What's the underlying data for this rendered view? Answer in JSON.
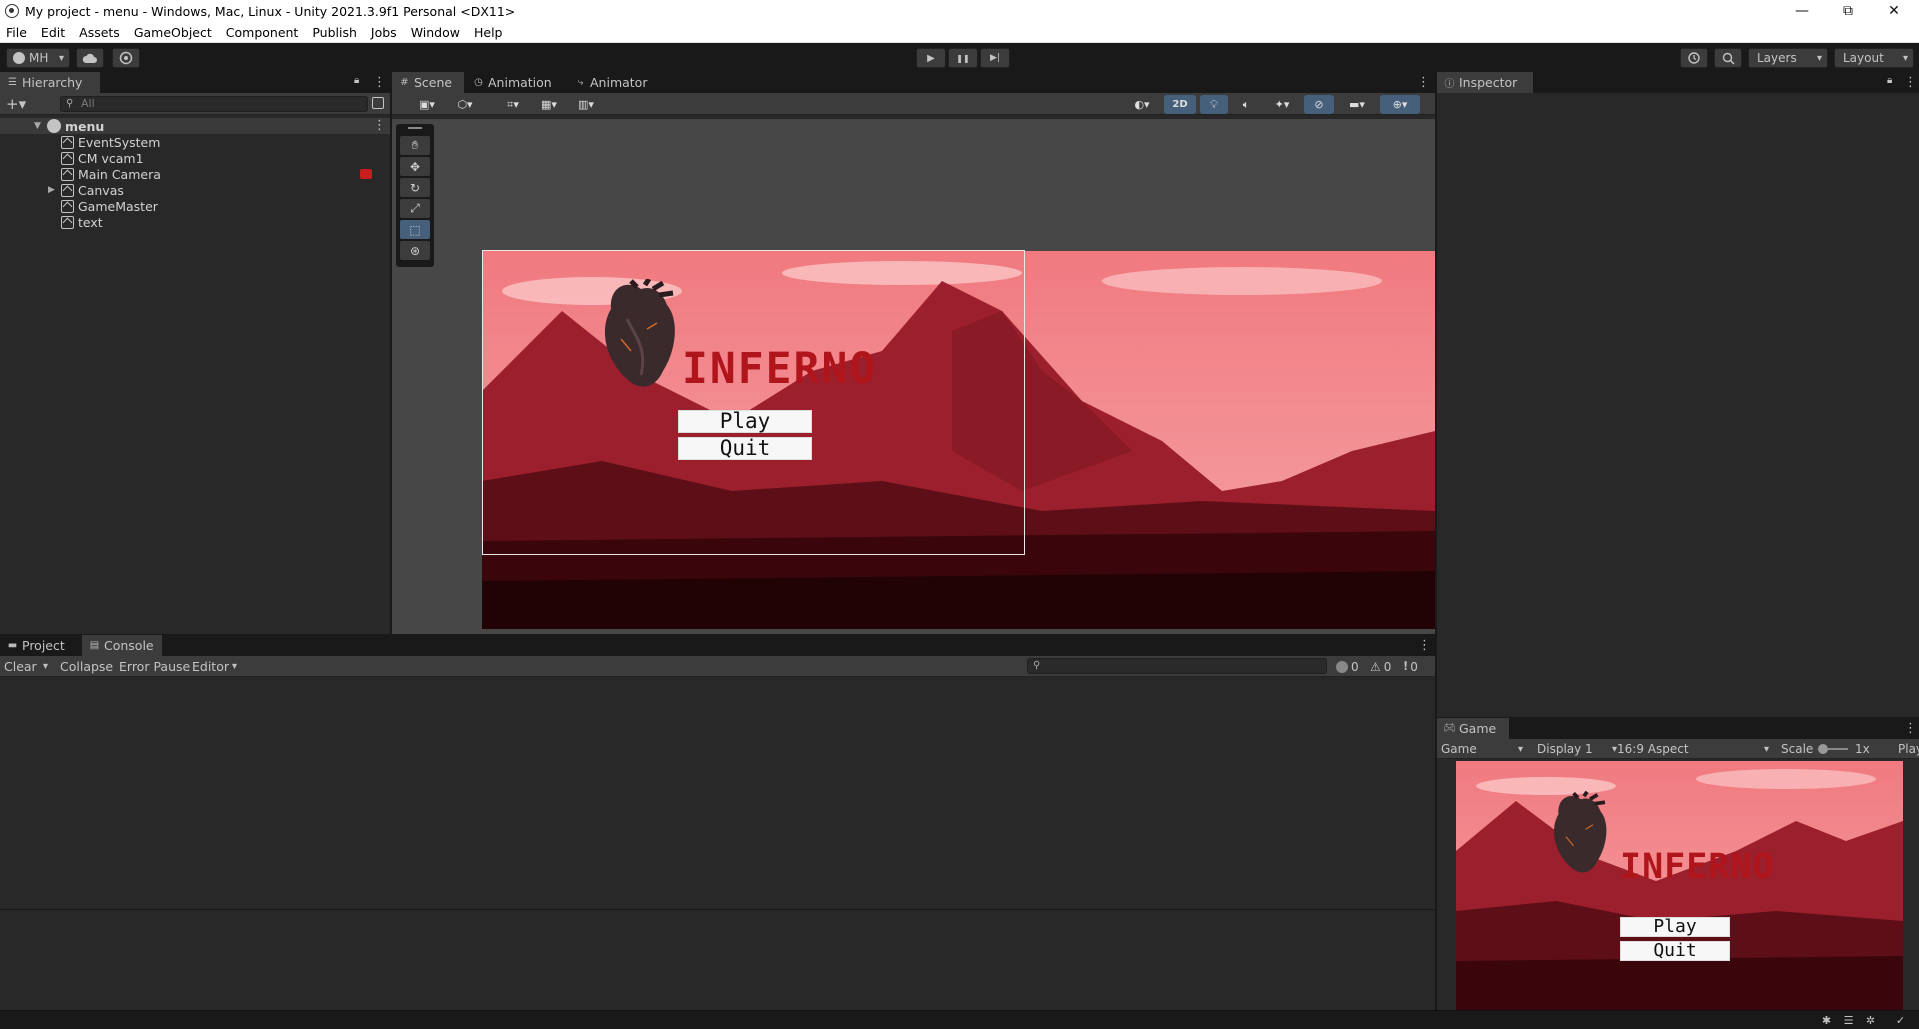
{
  "window": {
    "title": "My project - menu - Windows, Mac, Linux - Unity 2021.3.9f1 Personal <DX11>",
    "controls": {
      "minimize": "—",
      "maximize": "⧉",
      "close": "✕"
    }
  },
  "menu": [
    "File",
    "Edit",
    "Assets",
    "GameObject",
    "Component",
    "Publish",
    "Jobs",
    "Window",
    "Help"
  ],
  "toolbar": {
    "account": "MH",
    "play_icon": "▶",
    "pause_icon": "❚❚",
    "step_icon": "▶|",
    "layers": "Layers",
    "layout": "Layout"
  },
  "hierarchy": {
    "tab": "Hierarchy",
    "search_placeholder": "All",
    "scene": "menu",
    "items": [
      "EventSystem",
      "CM vcam1",
      "Main Camera",
      "Canvas",
      "GameMaster",
      "text"
    ]
  },
  "scene": {
    "tabs": [
      "Scene",
      "Animation",
      "Animator"
    ],
    "toggle_2d": "2D"
  },
  "game_ui": {
    "title": "INFERNO",
    "play_button": "Play",
    "quit_button": "Quit"
  },
  "inspector": {
    "tab": "Inspector"
  },
  "console": {
    "tabs": [
      "Project",
      "Console"
    ],
    "clear": "Clear",
    "collapse": "Collapse",
    "error_pause": "Error Pause",
    "editor": "Editor",
    "log_count": "0",
    "warn_count": "0",
    "error_count": "0"
  },
  "game": {
    "tab": "Game",
    "mode": "Game",
    "display": "Display 1",
    "aspect": "16:9 Aspect",
    "scale_label": "Scale",
    "scale_value": "1x",
    "play_label": "Play"
  },
  "colors": {
    "editor_dark": "#191919",
    "panel": "#282828",
    "tab_active": "#3c3c3c",
    "scene_bg": "#474747",
    "selection_blue": "#46607c",
    "title_red": "#b0151c"
  }
}
